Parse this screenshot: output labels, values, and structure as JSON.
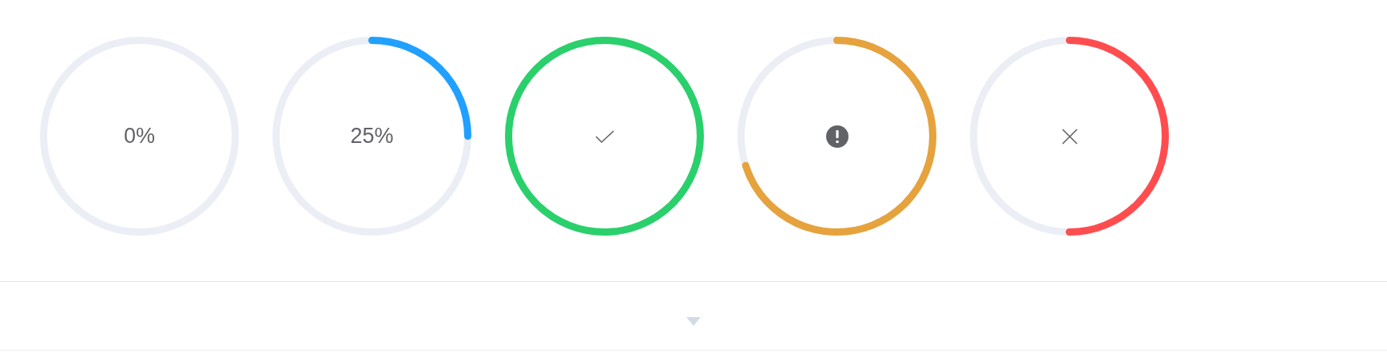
{
  "circles": [
    {
      "text": "0%",
      "kind": "text"
    },
    {
      "text": "25%",
      "kind": "text"
    },
    {
      "kind": "success"
    },
    {
      "kind": "warning"
    },
    {
      "kind": "exception"
    }
  ],
  "footer": {
    "expanded": false
  }
}
